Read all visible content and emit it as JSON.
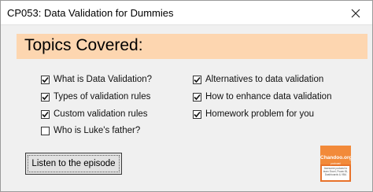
{
  "window": {
    "title": "CP053: Data Validation for Dummies",
    "close_label": "✕"
  },
  "banner": {
    "title": "Topics Covered:",
    "color": "#fdd6b0"
  },
  "topics": {
    "left": [
      {
        "label": "What is Data Validation?",
        "checked": true
      },
      {
        "label": "Types of validation rules",
        "checked": true
      },
      {
        "label": "Custom validation rules",
        "checked": true
      },
      {
        "label": "Who is Luke's father?",
        "checked": false
      }
    ],
    "right": [
      {
        "label": "Alternatives to data validation",
        "checked": true
      },
      {
        "label": "How to enhance data validation",
        "checked": true
      },
      {
        "label": "Homework problem for you",
        "checked": true
      }
    ]
  },
  "actions": {
    "listen_label": "Listen to the episode"
  },
  "podcast_logo": {
    "brand": "Chandoo.org",
    "subtitle": "podcast",
    "tagline": "Awesome podcast to learn Excel, Power BI, Dashboards & VBA",
    "color": "#e8722a"
  }
}
